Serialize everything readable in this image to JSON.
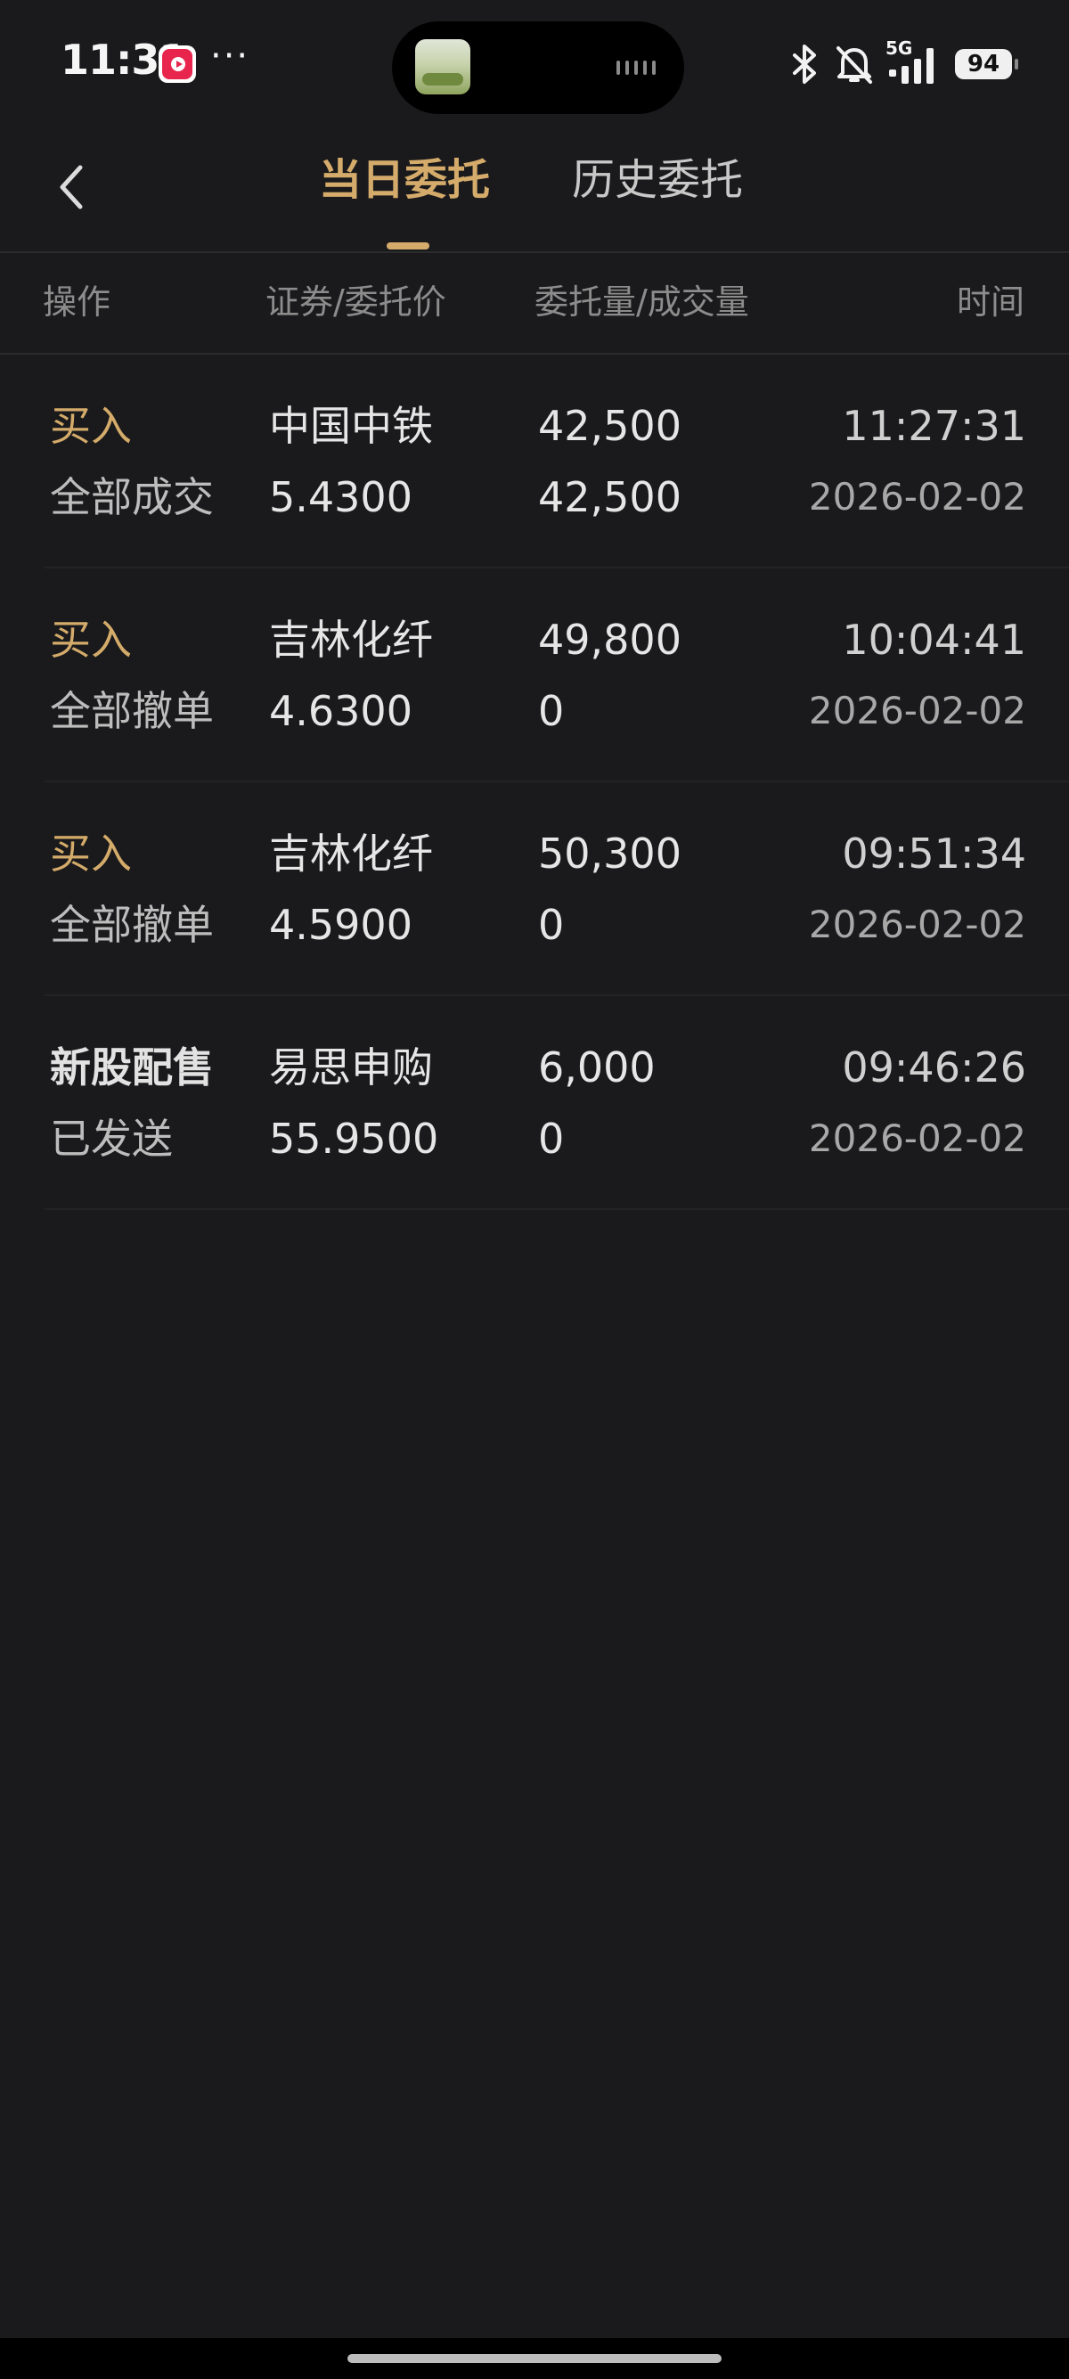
{
  "status_bar": {
    "time": "11:31",
    "more": "···",
    "network": "5G",
    "battery": "94",
    "icons": [
      "music-app-icon",
      "bluetooth-icon",
      "mute-icon",
      "signal-icon",
      "battery-icon"
    ]
  },
  "header": {
    "tabs": [
      {
        "label": "当日委托",
        "active": true
      },
      {
        "label": "历史委托",
        "active": false
      }
    ],
    "accent_color": "#d4ab6a"
  },
  "columns": {
    "action": "操作",
    "security": "证券/委托价",
    "quantity": "委托量/成交量",
    "time": "时间"
  },
  "orders": [
    {
      "action": "买入",
      "status": "全部成交",
      "security": "中国中铁",
      "price": "5.4300",
      "order_qty": "42,500",
      "filled_qty": "42,500",
      "time": "11:27:31",
      "date": "2026-02-02"
    },
    {
      "action": "买入",
      "status": "全部撤单",
      "security": "吉林化纤",
      "price": "4.6300",
      "order_qty": "49,800",
      "filled_qty": "0",
      "time": "10:04:41",
      "date": "2026-02-02"
    },
    {
      "action": "买入",
      "status": "全部撤单",
      "security": "吉林化纤",
      "price": "4.5900",
      "order_qty": "50,300",
      "filled_qty": "0",
      "time": "09:51:34",
      "date": "2026-02-02"
    },
    {
      "action": "新股配售",
      "status": "已发送",
      "security": "易思申购",
      "price": "55.9500",
      "order_qty": "6,000",
      "filled_qty": "0",
      "time": "09:46:26",
      "date": "2026-02-02"
    }
  ]
}
